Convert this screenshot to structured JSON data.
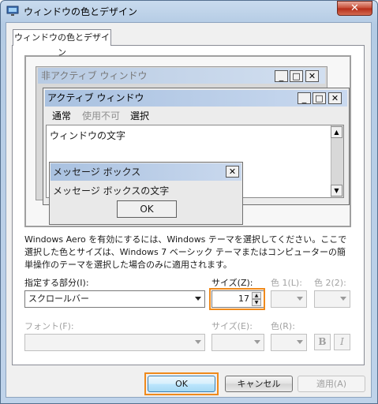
{
  "window": {
    "title": "ウィンドウの色とデザイン",
    "close_glyph": "✕"
  },
  "tabs": [
    {
      "label": "ウィンドウの色とデザイン"
    }
  ],
  "preview": {
    "inactive_window_title": "非アクティブ ウィンドウ",
    "active_window_title": "アクティブ ウィンドウ",
    "menu": [
      {
        "label": "通常",
        "state": "normal"
      },
      {
        "label": "使用不可",
        "state": "disabled"
      },
      {
        "label": "選択",
        "state": "selected"
      }
    ],
    "window_text": "ウィンドウの文字",
    "message_box_title": "メッセージ ボックス",
    "message_box_text": "メッセージ ボックスの文字",
    "message_box_ok": "OK",
    "caption_glyphs": {
      "minimize": "_",
      "maximize": "□",
      "close": "✕"
    }
  },
  "description": "Windows Aero を有効にするには、Windows テーマを選択してください。ここで選択した色とサイズは、Windows 7 ベーシック テーマまたはコンピューターの簡単操作のテーマを選択した場合のみに適用されます。",
  "item": {
    "label": "指定する部分(I):",
    "value": "スクロールバー",
    "size_label": "サイズ(Z):",
    "size_value": "17",
    "color1_label": "色 1(L):",
    "color2_label": "色 2(2):"
  },
  "font": {
    "label": "フォント(F):",
    "value": "",
    "size_label": "サイズ(E):",
    "color_label": "色(R):",
    "bold_label": "B",
    "italic_label": "I"
  },
  "buttons": {
    "ok": "OK",
    "cancel": "キャンセル",
    "apply": "適用(A)"
  },
  "colors": {
    "highlight": "#ef8a1c",
    "close_button": "#c64a34",
    "active_caption": "#a9c1e0"
  }
}
